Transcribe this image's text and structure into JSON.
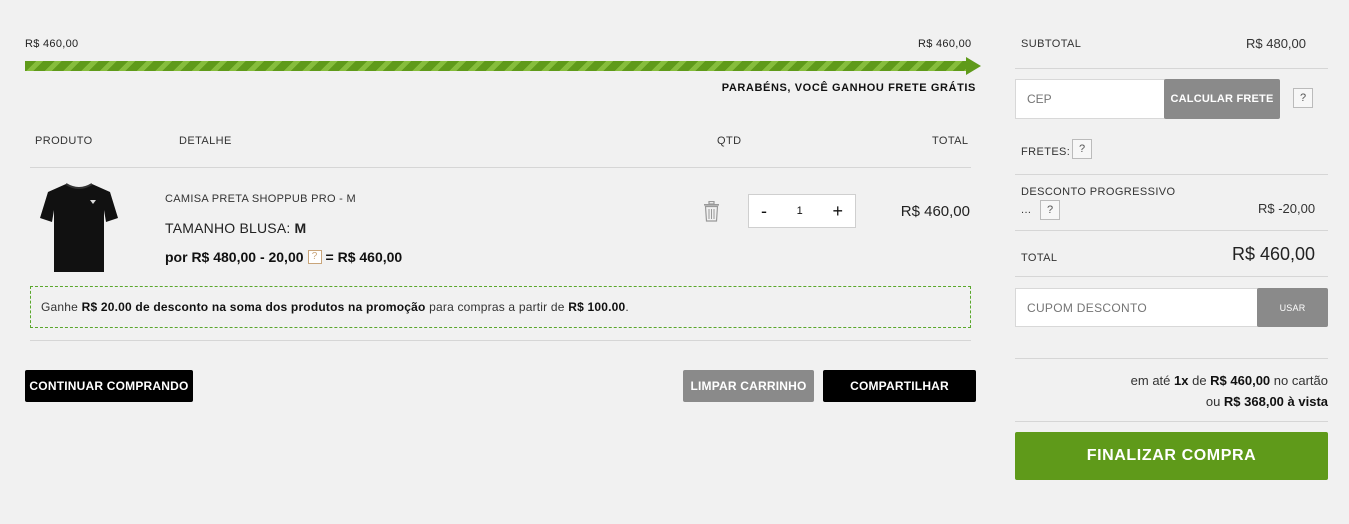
{
  "progress": {
    "left_label": "R$ 460,00",
    "right_label": "R$ 460,00",
    "fill_percent": 100,
    "message": "PARABÉNS, VOCÊ GANHOU FRETE GRÁTIS"
  },
  "table": {
    "headers": {
      "produto": "PRODUTO",
      "detalhe": "DETALHE",
      "qtd": "QTD",
      "total": "TOTAL"
    }
  },
  "item": {
    "name": "CAMISA PRETA SHOPPUB PRO - M",
    "size_label": "TAMANHO BLUSA: ",
    "size_value": "M",
    "price_prefix": "por R$ 480,00 - 20,00",
    "price_help": "?",
    "price_suffix": "= R$ 460,00",
    "quantity": "1",
    "minus": "-",
    "plus": "+",
    "total": "R$ 460,00"
  },
  "promo": {
    "text1": "Ganhe ",
    "bold1": "R$ 20.00 de desconto na soma dos produtos na promoção",
    "text2": " para compras a partir de ",
    "bold2": "R$ 100.00",
    "text3": "."
  },
  "actions": {
    "continue": "CONTINUAR COMPRANDO",
    "clear": "LIMPAR CARRINHO",
    "share": "COMPARTILHAR"
  },
  "summary": {
    "subtotal_label": "SUBTOTAL",
    "subtotal_value": "R$ 480,00",
    "cep_placeholder": "CEP",
    "calc_button": "CALCULAR FRETE",
    "help": "?",
    "fretes_label": "FRETES:",
    "discount_label": "DESCONTO PROGRESSIVO",
    "discount_ellipsis": "...",
    "discount_value": "R$ -20,00",
    "total_label": "TOTAL",
    "total_value": "R$ 460,00",
    "coupon_placeholder": "CUPOM DESCONTO",
    "coupon_button": "USAR",
    "install_prefix": "em até ",
    "install_times": "1x",
    "install_mid": " de ",
    "install_amount": "R$ 460,00",
    "install_suffix": " no cartão",
    "cash_prefix": "ou ",
    "cash_value": "R$ 368,00 à vista",
    "checkout": "FINALIZAR COMPRA"
  },
  "colors": {
    "accent": "#5f9a1a",
    "gray_button": "#8a8a8a",
    "dark_button": "#000000",
    "background": "#f1f1f1"
  }
}
